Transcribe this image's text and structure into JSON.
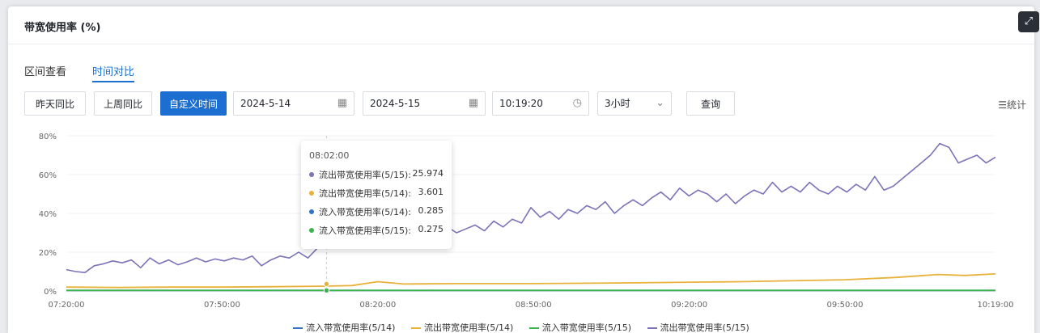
{
  "modal": {
    "title": "带宽使用率 (%)",
    "close_icon": "close-icon",
    "expand_icon": "expand-icon"
  },
  "tabs": [
    {
      "label": "区间查看",
      "active": false
    },
    {
      "label": "时间对比",
      "active": true
    }
  ],
  "toolbar": {
    "yesterday_label": "昨天同比",
    "lastweek_label": "上周同比",
    "custom_label": "自定义时间",
    "date1": "2024-5-14",
    "date2": "2024-5-15",
    "time": "10:19:20",
    "range": "3小时",
    "query_label": "查询",
    "stats_label": "统计"
  },
  "colors": {
    "accent": "#1c6fd1",
    "series_in_514": "#2f74c6",
    "series_out_514": "#e8b13a",
    "series_in_515": "#3bb54a",
    "series_out_515": "#7b73b8"
  },
  "tooltip": {
    "time": "08:02:00",
    "rows": [
      {
        "name": "流出带宽使用率(5/15):",
        "value": "25.974",
        "color": "#7b73b8"
      },
      {
        "name": "流出带宽使用率(5/14):",
        "value": "3.601",
        "color": "#e8b13a"
      },
      {
        "name": "流入带宽使用率(5/14):",
        "value": "0.285",
        "color": "#2f74c6"
      },
      {
        "name": "流入带宽使用率(5/15):",
        "value": "0.275",
        "color": "#3bb54a"
      }
    ]
  },
  "chart_data": {
    "type": "line",
    "title": "",
    "y_ticks": [
      "0%",
      "20%",
      "40%",
      "60%",
      "80%"
    ],
    "x_ticks": [
      "07:20:00",
      "07:50:00",
      "08:20:00",
      "08:50:00",
      "09:20:00",
      "09:50:00",
      "10:19:00"
    ],
    "ylim": [
      0,
      80
    ],
    "x_range_minutes": [
      0,
      179
    ],
    "grid": "horizontal",
    "legend_position": "bottom",
    "series": [
      {
        "name": "流入带宽使用率(5/14)",
        "color": "#2f74c6",
        "points": [
          [
            0,
            0.3
          ],
          [
            60,
            0.3
          ],
          [
            120,
            0.3
          ],
          [
            179,
            0.3
          ]
        ]
      },
      {
        "name": "流出带宽使用率(5/14)",
        "color": "#e8b13a",
        "points": [
          [
            0,
            2
          ],
          [
            10,
            1.8
          ],
          [
            20,
            2
          ],
          [
            30,
            2
          ],
          [
            40,
            2.2
          ],
          [
            50,
            2.5
          ],
          [
            55,
            2.8
          ],
          [
            60,
            4.8
          ],
          [
            65,
            3.6
          ],
          [
            75,
            3.8
          ],
          [
            90,
            3.8
          ],
          [
            110,
            4.2
          ],
          [
            130,
            4.8
          ],
          [
            150,
            5.8
          ],
          [
            160,
            7
          ],
          [
            168,
            8.5
          ],
          [
            173,
            8
          ],
          [
            179,
            8.8
          ]
        ]
      },
      {
        "name": "流入带宽使用率(5/15)",
        "color": "#3bb54a",
        "points": [
          [
            0,
            0.3
          ],
          [
            60,
            0.3
          ],
          [
            120,
            0.3
          ],
          [
            179,
            0.3
          ]
        ]
      },
      {
        "name": "流出带宽使用率(5/15)",
        "color": "#7b73b8",
        "points": [
          [
            0,
            11
          ],
          [
            2,
            10
          ],
          [
            4,
            9.5
          ],
          [
            6,
            13
          ],
          [
            8,
            14
          ],
          [
            10,
            15.5
          ],
          [
            12,
            14.5
          ],
          [
            14,
            16
          ],
          [
            16,
            12
          ],
          [
            18,
            17
          ],
          [
            20,
            14
          ],
          [
            22,
            16
          ],
          [
            24,
            13.5
          ],
          [
            26,
            15
          ],
          [
            28,
            17
          ],
          [
            30,
            15
          ],
          [
            32,
            16.5
          ],
          [
            34,
            15.5
          ],
          [
            36,
            17
          ],
          [
            38,
            16
          ],
          [
            40,
            18
          ],
          [
            42,
            13
          ],
          [
            44,
            16
          ],
          [
            46,
            18
          ],
          [
            48,
            17
          ],
          [
            50,
            20
          ],
          [
            52,
            17
          ],
          [
            54,
            22
          ],
          [
            56,
            26
          ],
          [
            58,
            30
          ],
          [
            60,
            28
          ],
          [
            62,
            31
          ],
          [
            64,
            29
          ],
          [
            66,
            33
          ],
          [
            68,
            32
          ],
          [
            70,
            30
          ],
          [
            72,
            35
          ],
          [
            74,
            33
          ],
          [
            76,
            36
          ],
          [
            78,
            34
          ],
          [
            80,
            31
          ],
          [
            82,
            33
          ],
          [
            84,
            30
          ],
          [
            86,
            32
          ],
          [
            88,
            34
          ],
          [
            90,
            31
          ],
          [
            92,
            36
          ],
          [
            94,
            33
          ],
          [
            96,
            37
          ],
          [
            98,
            35
          ],
          [
            100,
            43
          ],
          [
            102,
            38
          ],
          [
            104,
            41
          ],
          [
            106,
            37
          ],
          [
            108,
            42
          ],
          [
            110,
            40
          ],
          [
            112,
            44
          ],
          [
            114,
            42
          ],
          [
            116,
            46
          ],
          [
            118,
            40
          ],
          [
            120,
            44
          ],
          [
            122,
            47
          ],
          [
            124,
            44
          ],
          [
            126,
            48
          ],
          [
            128,
            51
          ],
          [
            130,
            47
          ],
          [
            132,
            53
          ],
          [
            134,
            49
          ],
          [
            136,
            52
          ],
          [
            138,
            50
          ],
          [
            140,
            46
          ],
          [
            142,
            50
          ],
          [
            144,
            45
          ],
          [
            146,
            49
          ],
          [
            148,
            52
          ],
          [
            150,
            50
          ],
          [
            152,
            56
          ],
          [
            154,
            51
          ],
          [
            156,
            54
          ],
          [
            158,
            51
          ],
          [
            160,
            56
          ],
          [
            162,
            52
          ],
          [
            164,
            50
          ],
          [
            166,
            54
          ],
          [
            168,
            51
          ],
          [
            170,
            55
          ],
          [
            172,
            52
          ],
          [
            174,
            59
          ],
          [
            176,
            52
          ],
          [
            178,
            54
          ],
          [
            180,
            58
          ],
          [
            182,
            62
          ],
          [
            184,
            66
          ],
          [
            186,
            70
          ],
          [
            188,
            76
          ],
          [
            190,
            74
          ],
          [
            192,
            66
          ],
          [
            194,
            68
          ],
          [
            196,
            70
          ],
          [
            198,
            66
          ],
          [
            200,
            69
          ]
        ]
      }
    ]
  }
}
